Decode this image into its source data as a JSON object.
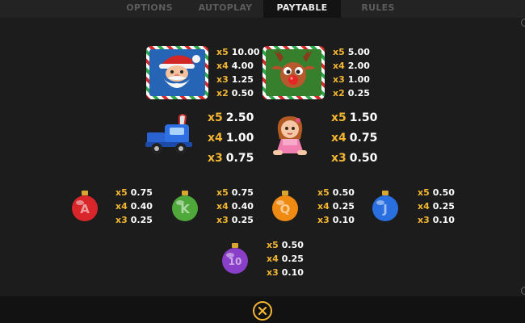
{
  "tabs": [
    {
      "label": "OPTIONS",
      "active": false
    },
    {
      "label": "AUTOPLAY",
      "active": false
    },
    {
      "label": "PAYTABLE",
      "active": true
    },
    {
      "label": "RULES",
      "active": false
    }
  ],
  "paytable": {
    "santa": {
      "icon": "santa-icon",
      "pays": [
        {
          "mult": "x5",
          "value": "10.00"
        },
        {
          "mult": "x4",
          "value": "4.00"
        },
        {
          "mult": "x3",
          "value": "1.25"
        },
        {
          "mult": "x2",
          "value": "0.50"
        }
      ]
    },
    "reindeer": {
      "icon": "reindeer-icon",
      "pays": [
        {
          "mult": "x5",
          "value": "5.00"
        },
        {
          "mult": "x4",
          "value": "2.00"
        },
        {
          "mult": "x3",
          "value": "1.00"
        },
        {
          "mult": "x2",
          "value": "0.25"
        }
      ]
    },
    "truck": {
      "icon": "toy-truck-icon",
      "pays": [
        {
          "mult": "x5",
          "value": "2.50"
        },
        {
          "mult": "x4",
          "value": "1.00"
        },
        {
          "mult": "x3",
          "value": "0.75"
        }
      ]
    },
    "doll": {
      "icon": "doll-icon",
      "pays": [
        {
          "mult": "x5",
          "value": "1.50"
        },
        {
          "mult": "x4",
          "value": "0.75"
        },
        {
          "mult": "x3",
          "value": "0.50"
        }
      ]
    },
    "ornament_a": {
      "icon": "red-ornament-a-icon",
      "letter": "A",
      "color": "#d8262b",
      "pays": [
        {
          "mult": "x5",
          "value": "0.75"
        },
        {
          "mult": "x4",
          "value": "0.40"
        },
        {
          "mult": "x3",
          "value": "0.25"
        }
      ]
    },
    "ornament_k": {
      "icon": "green-ornament-k-icon",
      "letter": "K",
      "color": "#4fa83a",
      "pays": [
        {
          "mult": "x5",
          "value": "0.75"
        },
        {
          "mult": "x4",
          "value": "0.40"
        },
        {
          "mult": "x3",
          "value": "0.25"
        }
      ]
    },
    "ornament_q": {
      "icon": "orange-ornament-q-icon",
      "letter": "Q",
      "color": "#ef8b12",
      "pays": [
        {
          "mult": "x5",
          "value": "0.50"
        },
        {
          "mult": "x4",
          "value": "0.25"
        },
        {
          "mult": "x3",
          "value": "0.10"
        }
      ]
    },
    "ornament_j": {
      "icon": "blue-ornament-j-icon",
      "letter": "J",
      "color": "#2a6fe0",
      "pays": [
        {
          "mult": "x5",
          "value": "0.50"
        },
        {
          "mult": "x4",
          "value": "0.25"
        },
        {
          "mult": "x3",
          "value": "0.10"
        }
      ]
    },
    "ornament_10": {
      "icon": "purple-ornament-10-icon",
      "letter": "10",
      "color": "#8a3fc8",
      "pays": [
        {
          "mult": "x5",
          "value": "0.50"
        },
        {
          "mult": "x4",
          "value": "0.25"
        },
        {
          "mult": "x3",
          "value": "0.10"
        }
      ]
    }
  },
  "close_icon": "close-icon",
  "accent_color": "#f2b632"
}
